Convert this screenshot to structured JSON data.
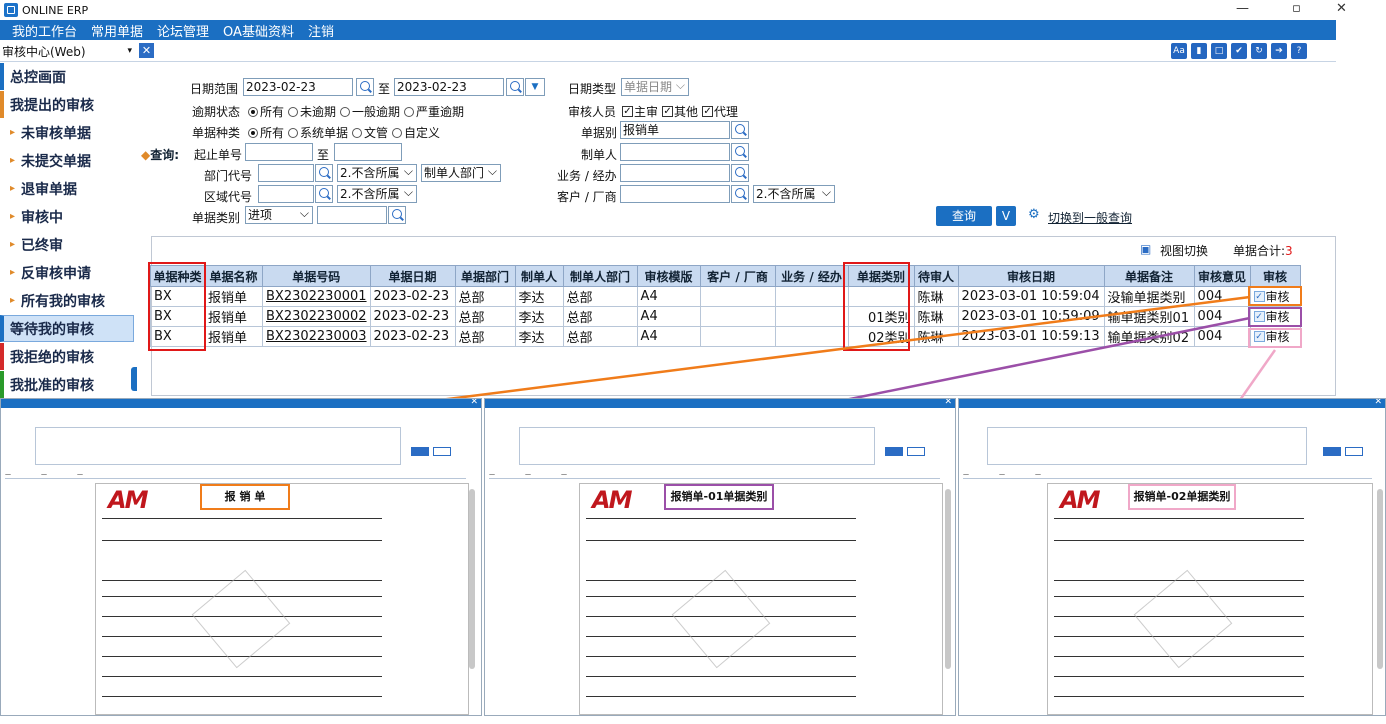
{
  "app": {
    "title": "ONLINE ERP"
  },
  "menu": [
    "我的工作台",
    "常用单据",
    "论坛管理",
    "OA基础资料",
    "注销"
  ],
  "module_select": "审核中心(Web)",
  "sidebar": [
    "总控画面",
    "我提出的审核",
    "未审核单据",
    "未提交单据",
    "退审单据",
    "审核中",
    "已终审",
    "反审核申请",
    "所有我的审核",
    "等待我的审核",
    "我拒绝的审核",
    "我批准的审核"
  ],
  "form": {
    "date_range_label": "日期范围",
    "date_from": "2023-02-23",
    "to": "至",
    "date_to": "2023-02-23",
    "date_type_label": "日期类型",
    "date_type": "单据日期",
    "overdue_label": "逾期状态",
    "overdue_opts": [
      "所有",
      "未逾期",
      "一般逾期",
      "严重逾期"
    ],
    "auditor_label": "审核人员",
    "auditor_opts": [
      "主审",
      "其他",
      "代理"
    ],
    "doctype_label": "单据种类",
    "doctype_opts": [
      "所有",
      "系统单据",
      "文管",
      "自定义"
    ],
    "docsort_label": "单据别",
    "docsort_value": "报销单",
    "query_label": "查询:",
    "docno_label": "起止单号",
    "maker_label": "制单人",
    "dept_label": "部门代号",
    "dept_scope": "2.不含所属",
    "dept_kind": "制单人部门",
    "biz_label": "业务 / 经办",
    "area_label": "区域代号",
    "area_scope": "2.不含所属",
    "cust_label": "客户 / 厂商",
    "cust_scope": "2.不含所属",
    "category_label": "单据类别",
    "category_value": "进项",
    "query_btn": "查询",
    "v_btn": "V",
    "switch_link": "切换到一般查询"
  },
  "grid": {
    "view_switch": "视图切换",
    "total_label": "单据合计:",
    "total": "3",
    "headers": [
      "单据种类",
      "单据名称",
      "单据号码",
      "单据日期",
      "单据部门",
      "制单人",
      "制单人部门",
      "审核模版",
      "客户 / 厂商",
      "业务 / 经办",
      "单据类别",
      "待审人",
      "审核日期",
      "单据备注",
      "审核意见",
      "审核"
    ],
    "rows": [
      [
        "BX",
        "报销单",
        "BX2302230001",
        "2023-02-23",
        "总部",
        "李达",
        "总部",
        "A4",
        "",
        "",
        "",
        "陈琳",
        "2023-03-01 10:59:04",
        "没输单据类别",
        "004",
        "审核"
      ],
      [
        "BX",
        "报销单",
        "BX2302230002",
        "2023-02-23",
        "总部",
        "李达",
        "总部",
        "A4",
        "",
        "",
        "01类别",
        "陈琳",
        "2023-03-01 10:59:09",
        "输单据类别01",
        "004",
        "审核"
      ],
      [
        "BX",
        "报销单",
        "BX2302230003",
        "2023-02-23",
        "总部",
        "李达",
        "总部",
        "A4",
        "",
        "",
        "02类别",
        "陈琳",
        "2023-03-01 10:59:13",
        "输单据类别02",
        "004",
        "审核"
      ]
    ]
  },
  "dialogs": [
    {
      "doc_title": "报 销 单",
      "color": "#f07c1a"
    },
    {
      "doc_title": "报销单-01单据类别",
      "color": "#9b4fa8"
    },
    {
      "doc_title": "报销单-02单据类别",
      "color": "#f0a8c8"
    }
  ],
  "colors": {
    "accent": "#1b6fc2",
    "highlight_red": "#e01818"
  }
}
